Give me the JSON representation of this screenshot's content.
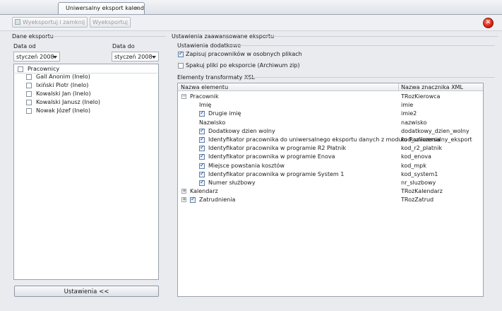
{
  "window": {
    "tab_title": "Uniwersalny eksport kalend",
    "tab_close": "×"
  },
  "toolbar": {
    "export_close_label": "Wyeksportuj i zamknij",
    "export_label": "Wyeksportuj",
    "close_icon": "close-red-icon"
  },
  "left": {
    "section_title": "Dane eksportu",
    "date_from_label": "Data od",
    "date_to_label": "Data do",
    "date_from_value": "styczeń 2008",
    "date_to_value": "styczeń 2008",
    "list_header": "Pracownicy",
    "employees": [
      "Gall Anonim (Inelo)",
      "Ixiński Piotr (Inelo)",
      "Kowalski Jan (Inelo)",
      "Kowalski Janusz (Inelo)",
      "Nowak Józef (Inelo)"
    ],
    "settings_button": "Ustawienia <<"
  },
  "right": {
    "section_title": "Ustawienia zaawansowane eksportu",
    "extra_title": "Ustawienia dodatkowe",
    "opt_separate_files": "Zapisuj pracowników w osobnych plikach",
    "opt_separate_files_checked": true,
    "opt_zip": "Spakuj pliki po eksporcie (Archiwum zip)",
    "opt_zip_checked": false,
    "xsl_title": "Elementy transformaty XSL",
    "col_element": "Nazwa elementu",
    "col_tag": "Nazwa znacznika XML",
    "tree": [
      {
        "name": "Pracownik",
        "tag": "TRozKierowca",
        "level": 0,
        "expander": "−",
        "checkbox": false
      },
      {
        "name": "Imię",
        "tag": "imie",
        "level": 1,
        "expander": "",
        "checkbox": false
      },
      {
        "name": "Drugie imię",
        "tag": "imie2",
        "level": 1,
        "expander": "",
        "checkbox": true
      },
      {
        "name": "Nazwisko",
        "tag": "nazwisko",
        "level": 1,
        "expander": "",
        "checkbox": false
      },
      {
        "name": "Dodatkowy dzien wolny",
        "tag": "dodatkowy_dzien_wolny",
        "level": 1,
        "expander": "",
        "checkbox": true
      },
      {
        "name": "Identyfikator pracownika do uniwersalnego eksportu danych z modułu Rozliczenia",
        "tag": "kod_uniwersalny_eksport",
        "level": 1,
        "expander": "",
        "checkbox": true
      },
      {
        "name": "Identyfikator pracownika w programie R2 Płatnik",
        "tag": "kod_r2_platnik",
        "level": 1,
        "expander": "",
        "checkbox": true
      },
      {
        "name": "Identyfikator pracownika w programie Enova",
        "tag": "kod_enova",
        "level": 1,
        "expander": "",
        "checkbox": true
      },
      {
        "name": "Miejsce powstania kosztów",
        "tag": "kod_mpk",
        "level": 1,
        "expander": "",
        "checkbox": true
      },
      {
        "name": "Identyfikator pracownika w programie System 1",
        "tag": "kod_system1",
        "level": 1,
        "expander": "",
        "checkbox": true
      },
      {
        "name": "Numer służbowy",
        "tag": "nr_sluzbowy",
        "level": 1,
        "expander": "",
        "checkbox": true
      },
      {
        "name": "Kalendarz",
        "tag": "TRozKalendarz",
        "level": 0,
        "expander": "+",
        "checkbox": false
      },
      {
        "name": "Zatrudnienia",
        "tag": "TRozZatrud",
        "level": 0,
        "expander": "+",
        "checkbox": true
      }
    ]
  }
}
